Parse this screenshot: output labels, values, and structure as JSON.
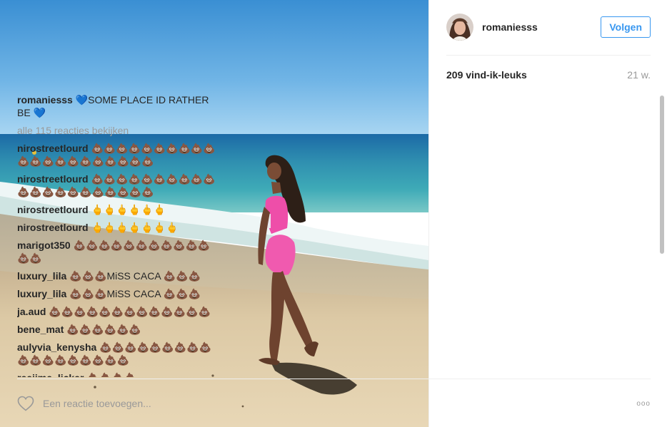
{
  "post": {
    "owner": "romaniesss",
    "follow_label": "Volgen",
    "likes": "209 vind-ik-leuks",
    "age": "21 w."
  },
  "caption": {
    "user": "romaniesss",
    "text": "💙SOME PLACE ID RATHER BE 💙"
  },
  "view_all": "alle 115 reacties bekijken",
  "comments": [
    {
      "user": "nirostreetlourd",
      "text": "💩💩💩💩💩💩💩💩💩💩💩💩💩💩💩💩💩💩💩💩💩"
    },
    {
      "user": "nirostreetlourd",
      "text": "💩💩💩💩💩💩💩💩💩💩💩💩💩💩💩💩💩💩💩💩💩"
    },
    {
      "user": "nirostreetlourd",
      "text": "🖕🖕🖕🖕🖕🖕"
    },
    {
      "user": "nirostreetlourd",
      "text": "🖕🖕🖕🖕🖕🖕🖕"
    },
    {
      "user": "marigot350",
      "text": "💩💩💩💩💩💩💩💩💩💩💩💩💩"
    },
    {
      "user": "luxury_lila",
      "text": "💩💩💩MiSS CACA 💩💩💩"
    },
    {
      "user": "luxury_lila",
      "text": "💩💩💩MiSS CACA 💩💩💩"
    },
    {
      "user": "ja.aud",
      "text": "💩💩💩💩💩💩💩💩💩💩💩💩💩"
    },
    {
      "user": "bene_mat",
      "text": "💩💩💩💩💩💩"
    },
    {
      "user": "aulyvia_kenysha",
      "text": "💩💩💩💩💩💩💩💩💩💩💩💩💩💩💩💩💩💩"
    },
    {
      "user": "reejime_licker",
      "text": "💩💩💩💩"
    }
  ],
  "comment_input": {
    "placeholder": "Een reactie toevoegen..."
  },
  "more_label": "ooo",
  "colors": {
    "accent": "#3897f0",
    "muted": "#999999",
    "text": "#262626"
  },
  "icons": {
    "like": "heart-outline-icon",
    "more": "more-options-icon"
  }
}
